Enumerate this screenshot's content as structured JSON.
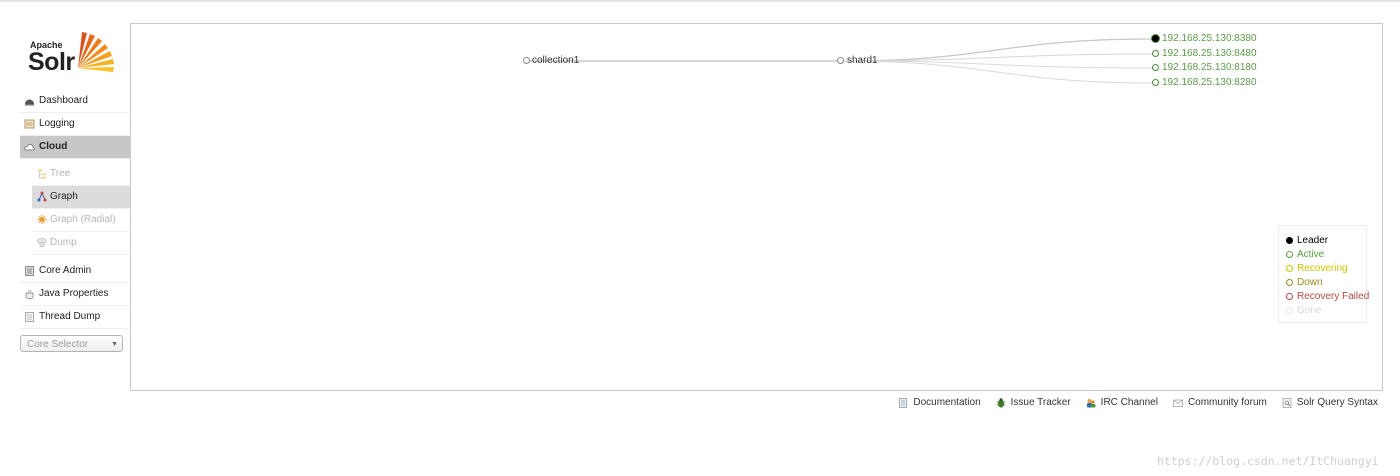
{
  "logo": {
    "brand_top": "Apache",
    "brand_main": "Solr"
  },
  "sidebar": {
    "items": [
      {
        "label": "Dashboard",
        "icon": "dashboard-icon"
      },
      {
        "label": "Logging",
        "icon": "logging-icon"
      },
      {
        "label": "Cloud",
        "icon": "cloud-icon",
        "active": true
      }
    ],
    "cloud_subitems": [
      {
        "label": "Tree",
        "icon": "tree-icon"
      },
      {
        "label": "Graph",
        "icon": "graph-icon",
        "active": true
      },
      {
        "label": "Graph (Radial)",
        "icon": "graph-radial-icon"
      },
      {
        "label": "Dump",
        "icon": "dump-icon"
      }
    ],
    "lower_items": [
      {
        "label": "Core Admin",
        "icon": "core-admin-icon"
      },
      {
        "label": "Java Properties",
        "icon": "java-properties-icon"
      },
      {
        "label": "Thread Dump",
        "icon": "thread-dump-icon"
      }
    ],
    "core_selector": {
      "placeholder": "Core Selector"
    }
  },
  "graph": {
    "collection": "collection1",
    "shard": "shard1",
    "replicas": [
      {
        "address": "192.168.25.130:8380",
        "state": "leader-active"
      },
      {
        "address": "192.168.25.130:8480",
        "state": "active"
      },
      {
        "address": "192.168.25.130:8180",
        "state": "active"
      },
      {
        "address": "192.168.25.130:8280",
        "state": "active"
      }
    ]
  },
  "legend": [
    {
      "label": "Leader",
      "color": "#000000"
    },
    {
      "label": "Active",
      "color": "#57a040"
    },
    {
      "label": "Recovering",
      "color": "#c8c800"
    },
    {
      "label": "Down",
      "color": "#9a8a20"
    },
    {
      "label": "Recovery Failed",
      "color": "#b24a4a"
    },
    {
      "label": "Gone",
      "color": "#d8d8d8"
    }
  ],
  "footer": [
    {
      "label": "Documentation",
      "icon": "documentation-icon"
    },
    {
      "label": "Issue Tracker",
      "icon": "issue-tracker-icon"
    },
    {
      "label": "IRC Channel",
      "icon": "irc-channel-icon"
    },
    {
      "label": "Community forum",
      "icon": "community-forum-icon"
    },
    {
      "label": "Solr Query Syntax",
      "icon": "solr-query-syntax-icon"
    }
  ],
  "watermark": "https://blog.csdn.net/ItChuangyi"
}
